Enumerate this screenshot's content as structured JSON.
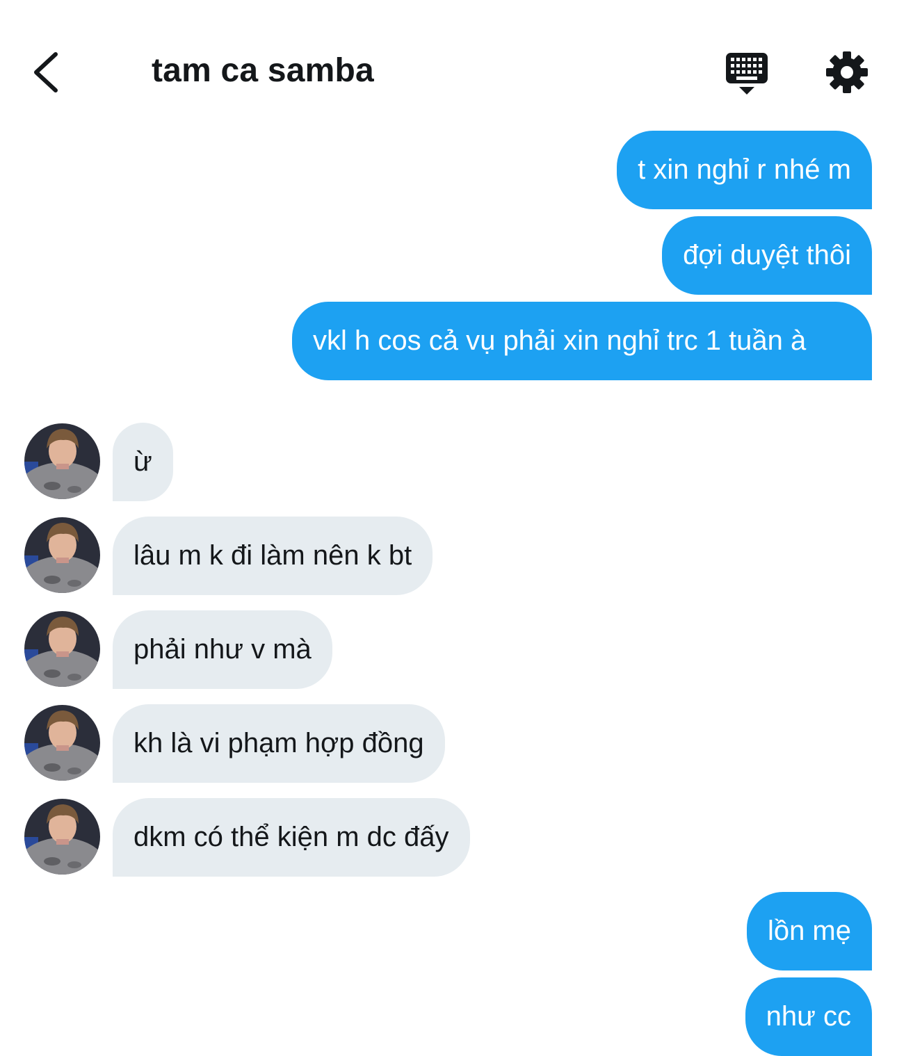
{
  "header": {
    "back_icon": "chevron-left-icon",
    "title": "tam ca samba",
    "keyboard_icon": "keyboard-icon",
    "settings_icon": "gear-icon"
  },
  "colors": {
    "outgoing_bubble": "#1da1f2",
    "incoming_bubble": "#e6ecf0",
    "text_dark": "#14171a"
  },
  "messages": [
    {
      "from": "me",
      "text": "t xin nghỉ r nhé m"
    },
    {
      "from": "me",
      "text": "đợi duyệt thôi"
    },
    {
      "from": "me",
      "text": "vkl h cos cả vụ phải xin nghỉ trc 1 tuần à"
    },
    {
      "from": "them",
      "text": "ừ"
    },
    {
      "from": "them",
      "text": "lâu m k đi làm nên k bt"
    },
    {
      "from": "them",
      "text": "phải như v mà"
    },
    {
      "from": "them",
      "text": "kh là vi phạm hợp đồng"
    },
    {
      "from": "them",
      "text": "dkm có thể kiện m dc đấy"
    },
    {
      "from": "me",
      "text": "lồn mẹ"
    },
    {
      "from": "me",
      "text": "như cc"
    }
  ]
}
